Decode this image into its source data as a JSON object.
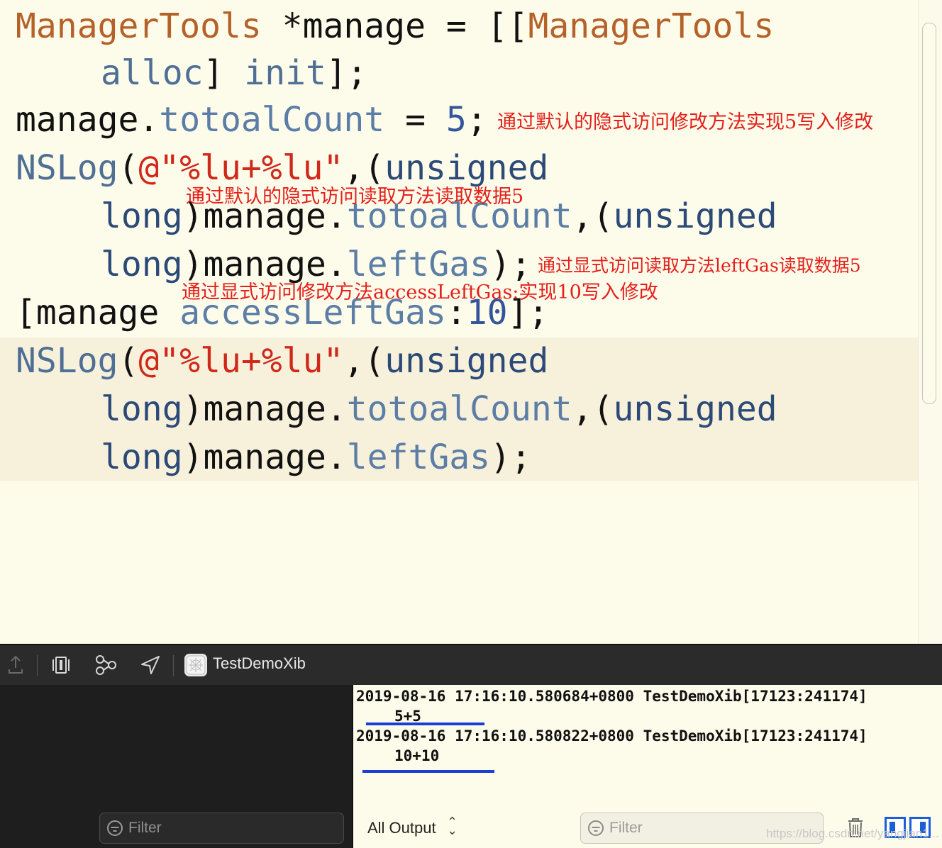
{
  "code": {
    "l1_type": "ManagerTools",
    "l1_var": " *manage = [[",
    "l1_cls": "ManagerTools",
    "l2_alloc": "alloc",
    "l2_mid": "] ",
    "l2_init": "init",
    "l2_end": "];",
    "l3_obj": "manage.",
    "l3_prop": "totoalCount",
    "l3_eq": " = ",
    "l3_num": "5",
    "l3_end": ";",
    "l4_fn": "NSLog",
    "l4_paren": "(",
    "l4_str": "@\"%lu+%lu\"",
    "l4_comma": ",(",
    "l4_kw": "unsigned",
    "l5_kw": "long",
    "l5_obj": ")manage.",
    "l5_prop": "totoalCount",
    "l5_comma": ",(",
    "l5_kw2": "unsigned",
    "l6_kw": "long",
    "l6_obj": ")manage.",
    "l6_prop": "leftGas",
    "l6_end": ");",
    "l7_open": "[manage ",
    "l7_method": "accessLeftGas",
    "l7_colon": ":",
    "l7_num": "10",
    "l7_end": "];",
    "l8_fn": "NSLog",
    "l8_paren": "(",
    "l8_str": "@\"%lu+%lu\"",
    "l8_comma": ",(",
    "l8_kw": "unsigned",
    "l9_kw": "long",
    "l9_obj": ")manage.",
    "l9_prop": "totoalCount",
    "l9_comma": ",(",
    "l9_kw2": "unsigned",
    "l10_kw": "long",
    "l10_obj": ")manage.",
    "l10_prop": "leftGas",
    "l10_end": ");"
  },
  "annotations": {
    "a1": "通过默认的隐式访问修改方法实现5写入修改",
    "a2": "通过默认的隐式访问读取方法读取数据5",
    "a3": "通过显式访问读取方法leftGas读取数据5",
    "a4": "通过显式访问修改方法accessLeftGas:实现10写入修改"
  },
  "debug_bar": {
    "target_name": "TestDemoXib",
    "icons": [
      "step-out-icon",
      "view-debugger-icon",
      "memory-graph-icon",
      "location-icon"
    ]
  },
  "console": {
    "log1_header": "2019-08-16 17:16:10.580684+0800 TestDemoXib[17123:241174]",
    "log1_value": "5+5",
    "log2_header": "2019-08-16 17:16:10.580822+0800 TestDemoXib[17123:241174]",
    "log2_value": "10+10",
    "output_selector": "All Output",
    "filter_placeholder": "Filter"
  },
  "variables_pane": {
    "filter_placeholder": "Filter"
  },
  "watermark": "https://blog.csdn.net/yangjian1..."
}
